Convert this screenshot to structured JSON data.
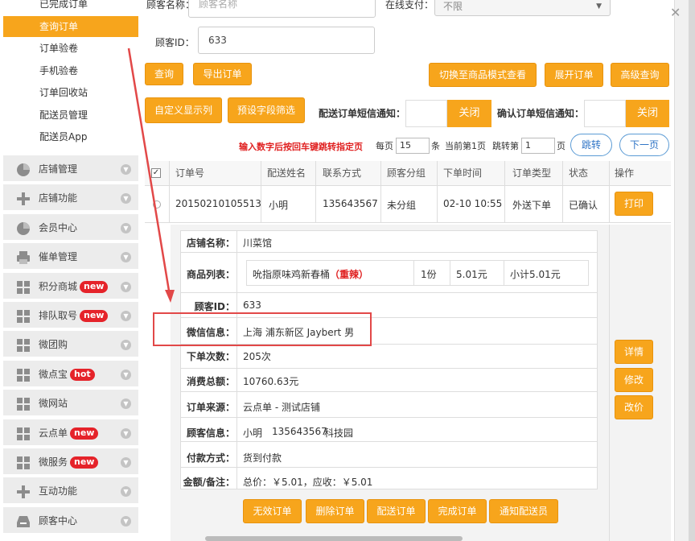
{
  "sidebar": {
    "sub_items": [
      "已完成订单",
      "查询订单",
      "订单验卷",
      "手机验卷",
      "订单回收站",
      "配送员管理",
      "配送员App"
    ],
    "active_sub": "查询订单",
    "menu": [
      {
        "label": "店铺管理",
        "icon": "pie-chart-icon",
        "badge": ""
      },
      {
        "label": "店铺功能",
        "icon": "plus-icon",
        "badge": ""
      },
      {
        "label": "会员中心",
        "icon": "pie-chart-icon",
        "badge": ""
      },
      {
        "label": "催单管理",
        "icon": "printer-icon",
        "badge": ""
      },
      {
        "label": "积分商城",
        "icon": "grid-icon",
        "badge": "new"
      },
      {
        "label": "排队取号",
        "icon": "grid-icon",
        "badge": "new"
      },
      {
        "label": "微团购",
        "icon": "grid-icon",
        "badge": ""
      },
      {
        "label": "微点宝",
        "icon": "grid-icon",
        "badge": "hot"
      },
      {
        "label": "微网站",
        "icon": "grid-icon",
        "badge": ""
      },
      {
        "label": "云点单",
        "icon": "grid-icon",
        "badge": "new"
      },
      {
        "label": "微服务",
        "icon": "grid-icon",
        "badge": "new"
      },
      {
        "label": "互动功能",
        "icon": "plus-icon",
        "badge": ""
      },
      {
        "label": "顾客中心",
        "icon": "inbox-icon",
        "badge": ""
      }
    ]
  },
  "filters": {
    "customer_name_label": "顾客名称：",
    "customer_name_placeholder": "顾客名称",
    "online_pay_label": "在线支付：",
    "online_pay_value": "不限",
    "customer_id_label": "顾客ID：",
    "customer_id_value": "633"
  },
  "buttons": {
    "query": "查询",
    "export": "导出订单",
    "switch_mode": "切换至商品模式查看",
    "expand": "展开订单",
    "advanced": "高级查询",
    "custom_columns": "自定义显示列",
    "preset_filter": "预设字段筛选",
    "print": "打印",
    "details": "详情",
    "modify": "修改",
    "change_price": "改价",
    "invalid": "无效订单",
    "delete": "删除订单",
    "deliver": "配送订单",
    "complete": "完成订单",
    "notify": "通知配送员"
  },
  "notifications": {
    "delivery_sms_label": "配送订单短信通知：",
    "delivery_sms_state": "关闭",
    "confirm_sms_label": "确认订单短信通知：",
    "confirm_sms_state": "关闭"
  },
  "pagination": {
    "note": "输入数字后按回车键跳转指定页",
    "per_page_label": "每页",
    "per_page_value": "15",
    "per_page_unit": "条",
    "current_page": "当前第1页",
    "jump_label": "跳转第",
    "jump_value": "1",
    "jump_unit": "页",
    "jump_button": "跳转",
    "next_button": "下一页"
  },
  "table": {
    "headers": [
      "订单号",
      "配送姓名",
      "联系方式",
      "顾客分组",
      "下单时间",
      "订单类型",
      "状态",
      "操作"
    ],
    "row": {
      "order_no": "20150210105513",
      "name": "小明",
      "phone": "135643567",
      "group": "未分组",
      "time": "02-10 10:55",
      "type": "外送下单",
      "status": "已确认"
    }
  },
  "detail": {
    "shop_label": "店铺名称：",
    "shop_value": "川菜馆",
    "products_label": "商品列表：",
    "product_name": "吮指原味鸡新春桶",
    "product_tag": "（重辣）",
    "product_qty": "1份",
    "product_price": "5.01元",
    "product_subtotal": "小计5.01元",
    "cid_label": "顾客ID：",
    "cid_value": "633",
    "wechat_label": "微信信息：",
    "wechat_value": "上海 浦东新区 Jaybert 男",
    "orders_label": "下单次数：",
    "orders_value": "205次",
    "total_label": "消费总额：",
    "total_value": "10760.63元",
    "source_label": "订单来源：",
    "source_value": "云点单 - 测试店铺",
    "cinfo_label": "顾客信息：",
    "cinfo_name": "小明",
    "cinfo_phone": "135643567",
    "cinfo_addr": "科技园",
    "pay_label": "付款方式：",
    "pay_value": "货到付款",
    "amount_label": "金额/备注：",
    "amount_value": "总价：￥5.01，应收：￥5.01"
  },
  "colors": {
    "accent": "#f7a51c",
    "annotation": "#e24848",
    "badge": "#e5232a",
    "link": "#2f74c6"
  }
}
